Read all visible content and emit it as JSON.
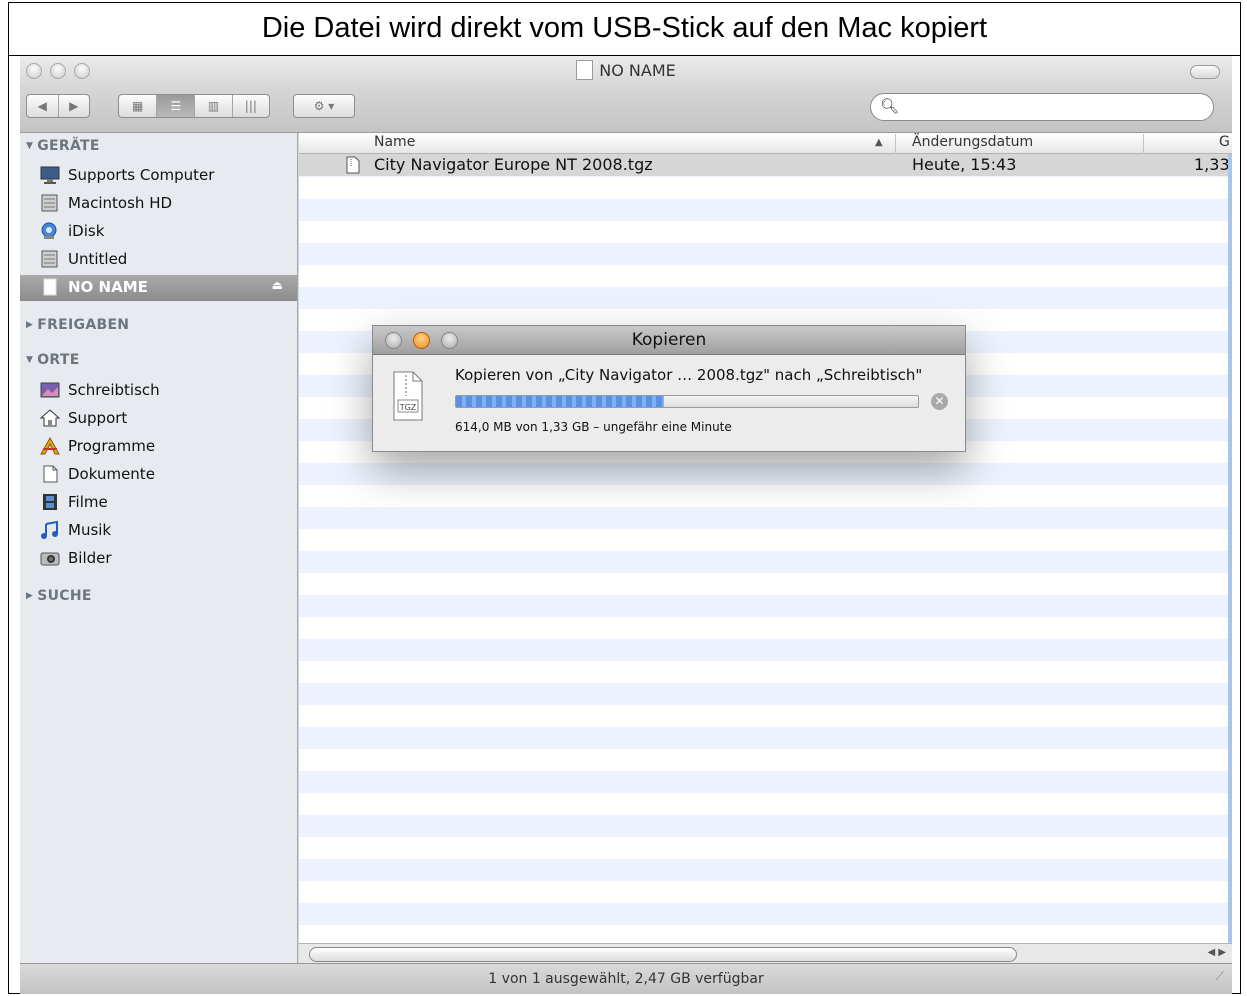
{
  "caption": "Die Datei wird direkt vom USB-Stick auf den Mac kopiert",
  "window": {
    "title": "NO NAME"
  },
  "toolbar": {
    "back_icon": "back-arrow",
    "forward_icon": "forward-arrow",
    "view_icons": [
      "icon-view",
      "list-view",
      "column-view",
      "coverflow-view"
    ],
    "action_icon": "gear-icon",
    "search_placeholder": ""
  },
  "sidebar": {
    "devices_header": "GERÄTE",
    "devices": [
      {
        "label": "Supports Computer",
        "icon": "computer-icon"
      },
      {
        "label": "Macintosh HD",
        "icon": "hard-disk-icon"
      },
      {
        "label": "iDisk",
        "icon": "idisk-icon"
      },
      {
        "label": "Untitled",
        "icon": "hard-disk-icon"
      },
      {
        "label": "NO NAME",
        "icon": "usb-drive-icon",
        "selected": true
      }
    ],
    "shared_header": "FREIGABEN",
    "places_header": "ORTE",
    "places": [
      {
        "label": "Schreibtisch",
        "icon": "desktop-icon"
      },
      {
        "label": "Support",
        "icon": "home-icon"
      },
      {
        "label": "Programme",
        "icon": "applications-icon"
      },
      {
        "label": "Dokumente",
        "icon": "documents-icon"
      },
      {
        "label": "Filme",
        "icon": "movies-icon"
      },
      {
        "label": "Musik",
        "icon": "music-icon"
      },
      {
        "label": "Bilder",
        "icon": "pictures-icon"
      }
    ],
    "search_header": "SUCHE"
  },
  "columns": {
    "name": "Name",
    "date": "Änderungsdatum",
    "size": "G"
  },
  "files": [
    {
      "name": "City Navigator Europe NT 2008.tgz",
      "date": "Heute, 15:43",
      "size": "1,33"
    }
  ],
  "status": "1 von 1 ausgewählt, 2,47 GB verfügbar",
  "dialog": {
    "title": "Kopieren",
    "message": "Kopieren von „City Navigator … 2008.tgz\" nach „Schreibtisch\"",
    "progress_fraction": 0.45,
    "detail": "614,0 MB von 1,33 GB – ungefähr eine Minute",
    "file_label": "TGZ"
  }
}
